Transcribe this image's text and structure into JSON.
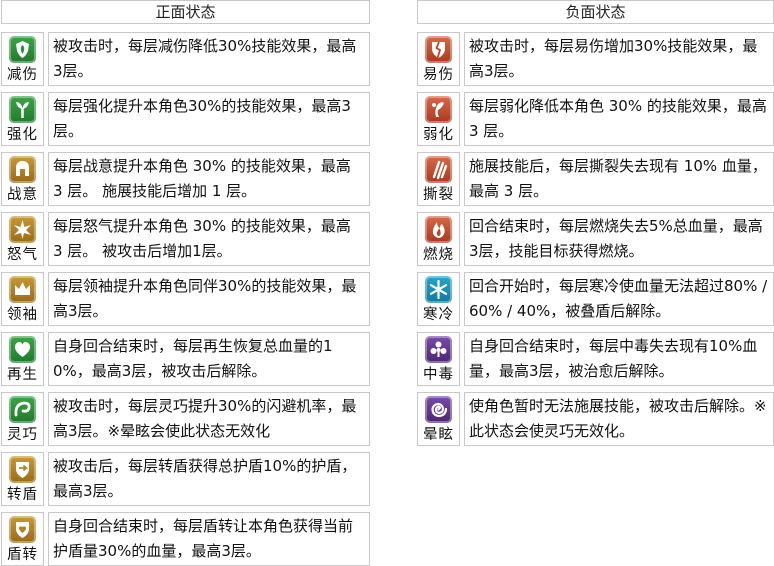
{
  "positive": {
    "header": "正面状态",
    "items": [
      {
        "name": "减伤",
        "icon": "leaf-shield-icon",
        "color": "#2e8f3a",
        "desc": "被攻击时，每层减伤降低30%技能效果，最高3层。"
      },
      {
        "name": "强化",
        "icon": "sprout-icon",
        "color": "#2e8f3a",
        "desc": "每层强化提升本角色30%的技能效果，最高3层。"
      },
      {
        "name": "战意",
        "icon": "helmet-icon",
        "color": "#b0832a",
        "desc": "每层战意提升本角色 30% 的技能效果，最高 3 层。 施展技能后增加 1 层。"
      },
      {
        "name": "怒气",
        "icon": "burst-icon",
        "color": "#b0832a",
        "desc": "每层怒气提升本角色 30% 的技能效果，最高 3 层。 被攻击后增加1层。"
      },
      {
        "name": "领袖",
        "icon": "crown-icon",
        "color": "#b0832a",
        "desc": "每层领袖提升本角色同伴30%的技能效果，最高3层。"
      },
      {
        "name": "再生",
        "icon": "heart-icon",
        "color": "#2e8f3a",
        "desc": "自身回合结束时，每层再生恢复总血量的10%，最高3层，被攻击后解除。"
      },
      {
        "name": "灵巧",
        "icon": "swirl-icon",
        "color": "#2e8f3a",
        "desc": "被攻击时，每层灵巧提升30%的闪避机率，最高3层。※晕眩会使此状态无效化"
      },
      {
        "name": "转盾",
        "icon": "shield-arrow-icon",
        "color": "#b0832a",
        "desc": "被攻击后，每层转盾获得总护盾10%的护盾，最高3层。"
      },
      {
        "name": "盾转",
        "icon": "shield-heart-icon",
        "color": "#b0832a",
        "desc": "自身回合结束时，每层盾转让本角色获得当前护盾量30%的血量，最高3层。"
      }
    ]
  },
  "negative": {
    "header": "负面状态",
    "items": [
      {
        "name": "易伤",
        "icon": "broken-shield-icon",
        "color": "#b8442a",
        "desc": "被攻击时，每层易伤增加30%技能效果，最高3层。"
      },
      {
        "name": "弱化",
        "icon": "wither-icon",
        "color": "#b8442a",
        "desc": "每层弱化降低本角色 30% 的技能效果，最高 3 层。"
      },
      {
        "name": "撕裂",
        "icon": "claw-icon",
        "color": "#b8442a",
        "desc": "施展技能后，每层撕裂失去现有 10% 血量，最高 3 层。"
      },
      {
        "name": "燃烧",
        "icon": "flame-icon",
        "color": "#b8442a",
        "desc": "回合结束时，每层燃烧失去5%总血量，最高3层，技能目标获得燃烧。"
      },
      {
        "name": "寒冷",
        "icon": "snowflake-icon",
        "color": "#1a8fb5",
        "desc": "回合开始时，每层寒冷使血量无法超过80% / 60% / 40%，被叠盾后解除。"
      },
      {
        "name": "中毒",
        "icon": "poison-icon",
        "color": "#5e3590",
        "desc": "自身回合结束时，每层中毒失去现有10%血量，最高3层，被治愈后解除。"
      },
      {
        "name": "晕眩",
        "icon": "spiral-icon",
        "color": "#5e3590",
        "desc": "使角色暂时无法施展技能，被攻击后解除。※此状态会使灵巧无效化。"
      }
    ]
  }
}
